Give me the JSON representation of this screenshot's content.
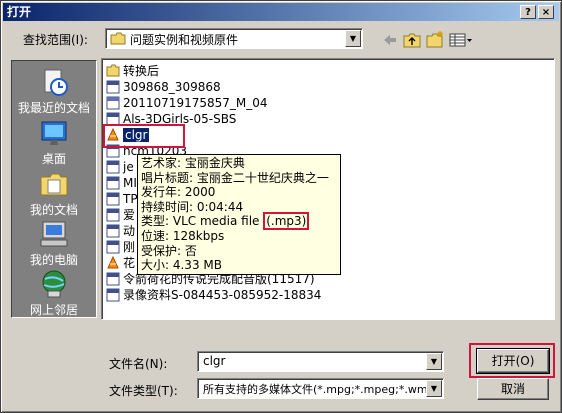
{
  "window": {
    "title": "打开",
    "help_button": "?",
    "close_button": "×"
  },
  "lookin": {
    "label": "查找范围(I):",
    "value": "问题实例和视频原件"
  },
  "toolbar": {
    "back": "back-icon",
    "up": "up-folder-icon",
    "newfolder": "new-folder-icon",
    "views": "views-menu-icon"
  },
  "places": [
    {
      "label": "我最近的文档",
      "icon": "recent-documents-icon"
    },
    {
      "label": "桌面",
      "icon": "desktop-icon"
    },
    {
      "label": "我的文档",
      "icon": "my-documents-icon"
    },
    {
      "label": "我的电脑",
      "icon": "my-computer-icon"
    },
    {
      "label": "网上邻居",
      "icon": "network-places-icon"
    }
  ],
  "files": [
    {
      "name": "转换后",
      "icon": "folder-icon"
    },
    {
      "name": "309868_309868",
      "icon": "media-file-icon"
    },
    {
      "name": "20110719175857_M_04",
      "icon": "mpeg-file-icon"
    },
    {
      "name": "Als-3DGirls-05-SBS",
      "icon": "media-file-icon"
    },
    {
      "name": "clgr",
      "icon": "vlc-file-icon",
      "selected": true
    },
    {
      "name": "hcm10203",
      "icon": "media-file-icon"
    },
    {
      "name": "je",
      "icon": "media-file-icon"
    },
    {
      "name": "MI",
      "icon": "media-file-icon"
    },
    {
      "name": "TP",
      "icon": "media-file-icon"
    },
    {
      "name": "爱",
      "icon": "media-file-icon"
    },
    {
      "name": "动",
      "icon": "media-file-icon"
    },
    {
      "name": "刚",
      "icon": "media-file-icon"
    },
    {
      "name": "花",
      "icon": "vlc-file-icon"
    },
    {
      "name": "令箭荷花的传说完成配音版(11517)",
      "icon": "media-file-icon"
    },
    {
      "name": "录像资料S-084453-085952-18834",
      "icon": "media-file-icon"
    }
  ],
  "tooltip": {
    "artist": "艺术家: 宝丽金庆典",
    "album": "唱片标题: 宝丽金二十世纪庆典之一",
    "year": "发行年: 2000",
    "duration": "持续时间: 0:04:44",
    "type_prefix": "类型: VLC media file ",
    "type_ext": "(.mp3)",
    "bitrate": "位速: 128kbps",
    "protected": "受保护: 否",
    "size": "大小: 4.33 MB"
  },
  "filename": {
    "label": "文件名(N):",
    "value": "clgr"
  },
  "filetype": {
    "label": "文件类型(T):",
    "value": "所有支持的多媒体文件(*.mpg;*.mpeg;*.wm"
  },
  "buttons": {
    "open": "打开(O)",
    "cancel": "取消"
  },
  "colors": {
    "highlight": "#d2143a",
    "selection": "#0a246a",
    "titlebar": "#0a246a",
    "tooltip_bg": "#ffffe1"
  }
}
